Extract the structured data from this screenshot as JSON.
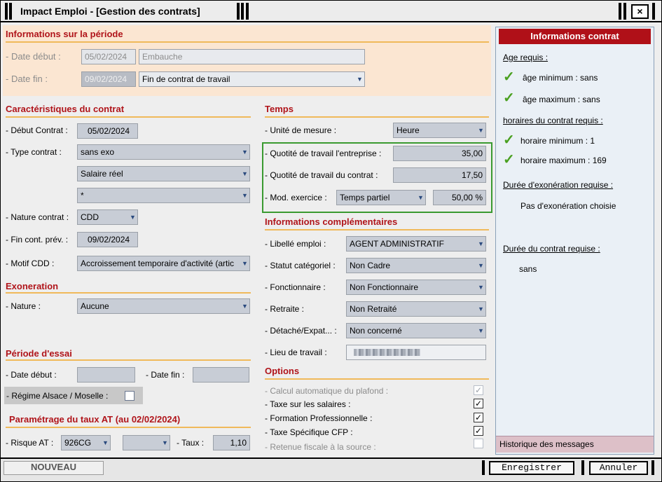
{
  "window": {
    "title": "Impact Emploi - [Gestion des contrats]",
    "close_label": "×"
  },
  "periode": {
    "title": "Informations sur la période",
    "date_debut_label": "- Date début :",
    "date_debut_value": "05/02/2024",
    "date_debut_type": "Embauche",
    "date_fin_label": "- Date fin :",
    "date_fin_value": "09/02/2024",
    "date_fin_type": "Fin de contrat de travail"
  },
  "caracteristiques": {
    "title": "Caractéristiques du contrat",
    "debut_label": "- Début Contrat :",
    "debut_value": "05/02/2024",
    "type_label": "- Type contrat :",
    "type_value": "sans exo",
    "salaire_value": "Salaire réel",
    "third_value": "*",
    "nature_label": "- Nature contrat :",
    "nature_value": "CDD",
    "fin_label": "- Fin cont. prév. :",
    "fin_value": "09/02/2024",
    "motif_label": "- Motif CDD :",
    "motif_value": "Accroissement temporaire d'activité (artic"
  },
  "exoneration": {
    "title": "Exoneration",
    "nature_label": "- Nature :",
    "nature_value": "Aucune"
  },
  "essai": {
    "title": "Période d'essai",
    "date_debut_label": "- Date début :",
    "date_fin_label": "- Date fin :",
    "alsace_label": "- Régime Alsace / Moselle :"
  },
  "taux_at": {
    "title": "Paramétrage du taux AT (au 02/02/2024)",
    "risque_label": "- Risque AT :",
    "risque_value": "926CG",
    "taux_label": "- Taux :",
    "taux_value": "1,10"
  },
  "temps": {
    "title": "Temps",
    "unite_label": "- Unité de mesure :",
    "unite_value": "Heure",
    "quotite_ent_label": "- Quotité de travail l'entreprise :",
    "quotite_ent_value": "35,00",
    "quotite_contrat_label": "- Quotité de travail du contrat :",
    "quotite_contrat_value": "17,50",
    "mod_label": "- Mod. exercice :",
    "mod_value": "Temps partiel",
    "mod_percent": "50,00 %"
  },
  "complementaires": {
    "title": "Informations complémentaires",
    "libelle_label": "- Libellé emploi :",
    "libelle_value": "AGENT ADMINISTRATIF",
    "statut_label": "- Statut catégoriel :",
    "statut_value": "Non Cadre",
    "fonctionnaire_label": "- Fonctionnaire :",
    "fonctionnaire_value": "Non Fonctionnaire",
    "retraite_label": "- Retraite :",
    "retraite_value": "Non Retraité",
    "detache_label": "- Détaché/Expat... :",
    "detache_value": "Non concerné",
    "lieu_label": "- Lieu de travail :"
  },
  "options": {
    "title": "Options",
    "items": [
      {
        "label": "- Calcul automatique du plafond :",
        "checked": true,
        "disabled": true
      },
      {
        "label": "- Taxe sur les salaires :",
        "checked": true,
        "disabled": false
      },
      {
        "label": "- Formation Professionnelle :",
        "checked": true,
        "disabled": false
      },
      {
        "label": "- Taxe Spécifique CFP :",
        "checked": true,
        "disabled": false
      },
      {
        "label": "- Retenue fiscale à la source :",
        "checked": false,
        "disabled": true
      }
    ]
  },
  "sidebar": {
    "title": "Informations contrat",
    "age_title": "Age requis :",
    "age_min": "âge minimum : sans",
    "age_max": "âge maximum : sans",
    "horaires_title": "horaires du contrat requis :",
    "horaire_min": "horaire minimum : 1",
    "horaire_max": "horaire maximum : 169",
    "duree_exo_title": "Durée d'exonération requise :",
    "duree_exo_value": "Pas d'exonération choisie",
    "duree_contrat_title": "Durée du contrat requise :",
    "duree_contrat_value": "sans",
    "historique": "Historique des messages"
  },
  "footer": {
    "nouveau": "NOUVEAU",
    "enregistrer": "Enregistrer",
    "annuler": "Annuler"
  },
  "colors": {
    "section_title": "#b0141a",
    "header_red": "#b01018",
    "accent_green": "#3a9a30",
    "periode_bg": "#fbe6d2"
  }
}
